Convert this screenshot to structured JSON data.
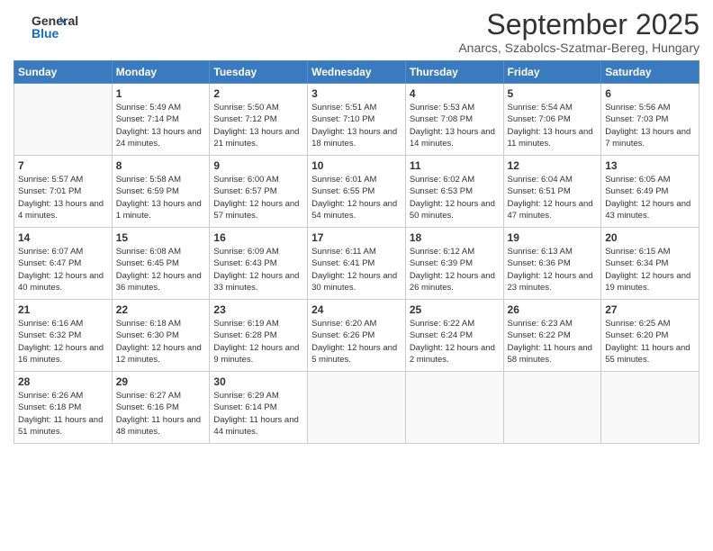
{
  "logo": {
    "general": "General",
    "blue": "Blue"
  },
  "header": {
    "month_title": "September 2025",
    "subtitle": "Anarcs, Szabolcs-Szatmar-Bereg, Hungary"
  },
  "weekdays": [
    "Sunday",
    "Monday",
    "Tuesday",
    "Wednesday",
    "Thursday",
    "Friday",
    "Saturday"
  ],
  "weeks": [
    [
      {
        "day": "",
        "sunrise": "",
        "sunset": "",
        "daylight": ""
      },
      {
        "day": "1",
        "sunrise": "Sunrise: 5:49 AM",
        "sunset": "Sunset: 7:14 PM",
        "daylight": "Daylight: 13 hours and 24 minutes."
      },
      {
        "day": "2",
        "sunrise": "Sunrise: 5:50 AM",
        "sunset": "Sunset: 7:12 PM",
        "daylight": "Daylight: 13 hours and 21 minutes."
      },
      {
        "day": "3",
        "sunrise": "Sunrise: 5:51 AM",
        "sunset": "Sunset: 7:10 PM",
        "daylight": "Daylight: 13 hours and 18 minutes."
      },
      {
        "day": "4",
        "sunrise": "Sunrise: 5:53 AM",
        "sunset": "Sunset: 7:08 PM",
        "daylight": "Daylight: 13 hours and 14 minutes."
      },
      {
        "day": "5",
        "sunrise": "Sunrise: 5:54 AM",
        "sunset": "Sunset: 7:06 PM",
        "daylight": "Daylight: 13 hours and 11 minutes."
      },
      {
        "day": "6",
        "sunrise": "Sunrise: 5:56 AM",
        "sunset": "Sunset: 7:03 PM",
        "daylight": "Daylight: 13 hours and 7 minutes."
      }
    ],
    [
      {
        "day": "7",
        "sunrise": "Sunrise: 5:57 AM",
        "sunset": "Sunset: 7:01 PM",
        "daylight": "Daylight: 13 hours and 4 minutes."
      },
      {
        "day": "8",
        "sunrise": "Sunrise: 5:58 AM",
        "sunset": "Sunset: 6:59 PM",
        "daylight": "Daylight: 13 hours and 1 minute."
      },
      {
        "day": "9",
        "sunrise": "Sunrise: 6:00 AM",
        "sunset": "Sunset: 6:57 PM",
        "daylight": "Daylight: 12 hours and 57 minutes."
      },
      {
        "day": "10",
        "sunrise": "Sunrise: 6:01 AM",
        "sunset": "Sunset: 6:55 PM",
        "daylight": "Daylight: 12 hours and 54 minutes."
      },
      {
        "day": "11",
        "sunrise": "Sunrise: 6:02 AM",
        "sunset": "Sunset: 6:53 PM",
        "daylight": "Daylight: 12 hours and 50 minutes."
      },
      {
        "day": "12",
        "sunrise": "Sunrise: 6:04 AM",
        "sunset": "Sunset: 6:51 PM",
        "daylight": "Daylight: 12 hours and 47 minutes."
      },
      {
        "day": "13",
        "sunrise": "Sunrise: 6:05 AM",
        "sunset": "Sunset: 6:49 PM",
        "daylight": "Daylight: 12 hours and 43 minutes."
      }
    ],
    [
      {
        "day": "14",
        "sunrise": "Sunrise: 6:07 AM",
        "sunset": "Sunset: 6:47 PM",
        "daylight": "Daylight: 12 hours and 40 minutes."
      },
      {
        "day": "15",
        "sunrise": "Sunrise: 6:08 AM",
        "sunset": "Sunset: 6:45 PM",
        "daylight": "Daylight: 12 hours and 36 minutes."
      },
      {
        "day": "16",
        "sunrise": "Sunrise: 6:09 AM",
        "sunset": "Sunset: 6:43 PM",
        "daylight": "Daylight: 12 hours and 33 minutes."
      },
      {
        "day": "17",
        "sunrise": "Sunrise: 6:11 AM",
        "sunset": "Sunset: 6:41 PM",
        "daylight": "Daylight: 12 hours and 30 minutes."
      },
      {
        "day": "18",
        "sunrise": "Sunrise: 6:12 AM",
        "sunset": "Sunset: 6:39 PM",
        "daylight": "Daylight: 12 hours and 26 minutes."
      },
      {
        "day": "19",
        "sunrise": "Sunrise: 6:13 AM",
        "sunset": "Sunset: 6:36 PM",
        "daylight": "Daylight: 12 hours and 23 minutes."
      },
      {
        "day": "20",
        "sunrise": "Sunrise: 6:15 AM",
        "sunset": "Sunset: 6:34 PM",
        "daylight": "Daylight: 12 hours and 19 minutes."
      }
    ],
    [
      {
        "day": "21",
        "sunrise": "Sunrise: 6:16 AM",
        "sunset": "Sunset: 6:32 PM",
        "daylight": "Daylight: 12 hours and 16 minutes."
      },
      {
        "day": "22",
        "sunrise": "Sunrise: 6:18 AM",
        "sunset": "Sunset: 6:30 PM",
        "daylight": "Daylight: 12 hours and 12 minutes."
      },
      {
        "day": "23",
        "sunrise": "Sunrise: 6:19 AM",
        "sunset": "Sunset: 6:28 PM",
        "daylight": "Daylight: 12 hours and 9 minutes."
      },
      {
        "day": "24",
        "sunrise": "Sunrise: 6:20 AM",
        "sunset": "Sunset: 6:26 PM",
        "daylight": "Daylight: 12 hours and 5 minutes."
      },
      {
        "day": "25",
        "sunrise": "Sunrise: 6:22 AM",
        "sunset": "Sunset: 6:24 PM",
        "daylight": "Daylight: 12 hours and 2 minutes."
      },
      {
        "day": "26",
        "sunrise": "Sunrise: 6:23 AM",
        "sunset": "Sunset: 6:22 PM",
        "daylight": "Daylight: 11 hours and 58 minutes."
      },
      {
        "day": "27",
        "sunrise": "Sunrise: 6:25 AM",
        "sunset": "Sunset: 6:20 PM",
        "daylight": "Daylight: 11 hours and 55 minutes."
      }
    ],
    [
      {
        "day": "28",
        "sunrise": "Sunrise: 6:26 AM",
        "sunset": "Sunset: 6:18 PM",
        "daylight": "Daylight: 11 hours and 51 minutes."
      },
      {
        "day": "29",
        "sunrise": "Sunrise: 6:27 AM",
        "sunset": "Sunset: 6:16 PM",
        "daylight": "Daylight: 11 hours and 48 minutes."
      },
      {
        "day": "30",
        "sunrise": "Sunrise: 6:29 AM",
        "sunset": "Sunset: 6:14 PM",
        "daylight": "Daylight: 11 hours and 44 minutes."
      },
      {
        "day": "",
        "sunrise": "",
        "sunset": "",
        "daylight": ""
      },
      {
        "day": "",
        "sunrise": "",
        "sunset": "",
        "daylight": ""
      },
      {
        "day": "",
        "sunrise": "",
        "sunset": "",
        "daylight": ""
      },
      {
        "day": "",
        "sunrise": "",
        "sunset": "",
        "daylight": ""
      }
    ]
  ]
}
